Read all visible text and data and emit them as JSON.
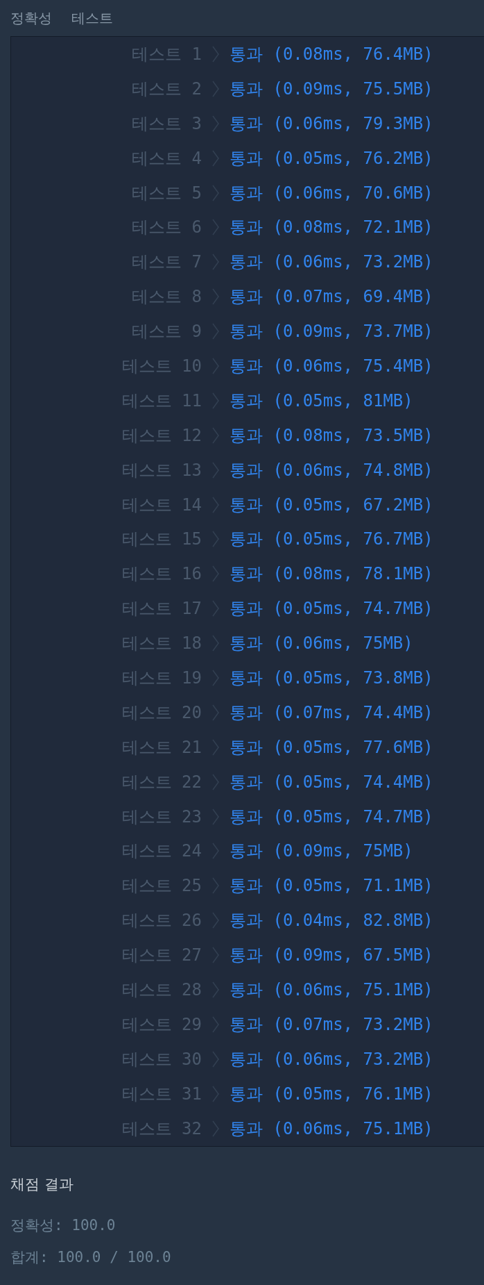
{
  "header": {
    "title": "정확성",
    "subtitle": "테스트"
  },
  "tests": [
    {
      "label": "테스트 1",
      "result": "통과 (0.08ms, 76.4MB)"
    },
    {
      "label": "테스트 2",
      "result": "통과 (0.09ms, 75.5MB)"
    },
    {
      "label": "테스트 3",
      "result": "통과 (0.06ms, 79.3MB)"
    },
    {
      "label": "테스트 4",
      "result": "통과 (0.05ms, 76.2MB)"
    },
    {
      "label": "테스트 5",
      "result": "통과 (0.06ms, 70.6MB)"
    },
    {
      "label": "테스트 6",
      "result": "통과 (0.08ms, 72.1MB)"
    },
    {
      "label": "테스트 7",
      "result": "통과 (0.06ms, 73.2MB)"
    },
    {
      "label": "테스트 8",
      "result": "통과 (0.07ms, 69.4MB)"
    },
    {
      "label": "테스트 9",
      "result": "통과 (0.09ms, 73.7MB)"
    },
    {
      "label": "테스트 10",
      "result": "통과 (0.06ms, 75.4MB)"
    },
    {
      "label": "테스트 11",
      "result": "통과 (0.05ms, 81MB)"
    },
    {
      "label": "테스트 12",
      "result": "통과 (0.08ms, 73.5MB)"
    },
    {
      "label": "테스트 13",
      "result": "통과 (0.06ms, 74.8MB)"
    },
    {
      "label": "테스트 14",
      "result": "통과 (0.05ms, 67.2MB)"
    },
    {
      "label": "테스트 15",
      "result": "통과 (0.05ms, 76.7MB)"
    },
    {
      "label": "테스트 16",
      "result": "통과 (0.08ms, 78.1MB)"
    },
    {
      "label": "테스트 17",
      "result": "통과 (0.05ms, 74.7MB)"
    },
    {
      "label": "테스트 18",
      "result": "통과 (0.06ms, 75MB)"
    },
    {
      "label": "테스트 19",
      "result": "통과 (0.05ms, 73.8MB)"
    },
    {
      "label": "테스트 20",
      "result": "통과 (0.07ms, 74.4MB)"
    },
    {
      "label": "테스트 21",
      "result": "통과 (0.05ms, 77.6MB)"
    },
    {
      "label": "테스트 22",
      "result": "통과 (0.05ms, 74.4MB)"
    },
    {
      "label": "테스트 23",
      "result": "통과 (0.05ms, 74.7MB)"
    },
    {
      "label": "테스트 24",
      "result": "통과 (0.09ms, 75MB)"
    },
    {
      "label": "테스트 25",
      "result": "통과 (0.05ms, 71.1MB)"
    },
    {
      "label": "테스트 26",
      "result": "통과 (0.04ms, 82.8MB)"
    },
    {
      "label": "테스트 27",
      "result": "통과 (0.09ms, 67.5MB)"
    },
    {
      "label": "테스트 28",
      "result": "통과 (0.06ms, 75.1MB)"
    },
    {
      "label": "테스트 29",
      "result": "통과 (0.07ms, 73.2MB)"
    },
    {
      "label": "테스트 30",
      "result": "통과 (0.06ms, 73.2MB)"
    },
    {
      "label": "테스트 31",
      "result": "통과 (0.05ms, 76.1MB)"
    },
    {
      "label": "테스트 32",
      "result": "통과 (0.06ms, 75.1MB)"
    }
  ],
  "summary": {
    "title": "채점 결과",
    "lines": [
      "정확성: 100.0",
      "합계: 100.0 / 100.0"
    ]
  }
}
